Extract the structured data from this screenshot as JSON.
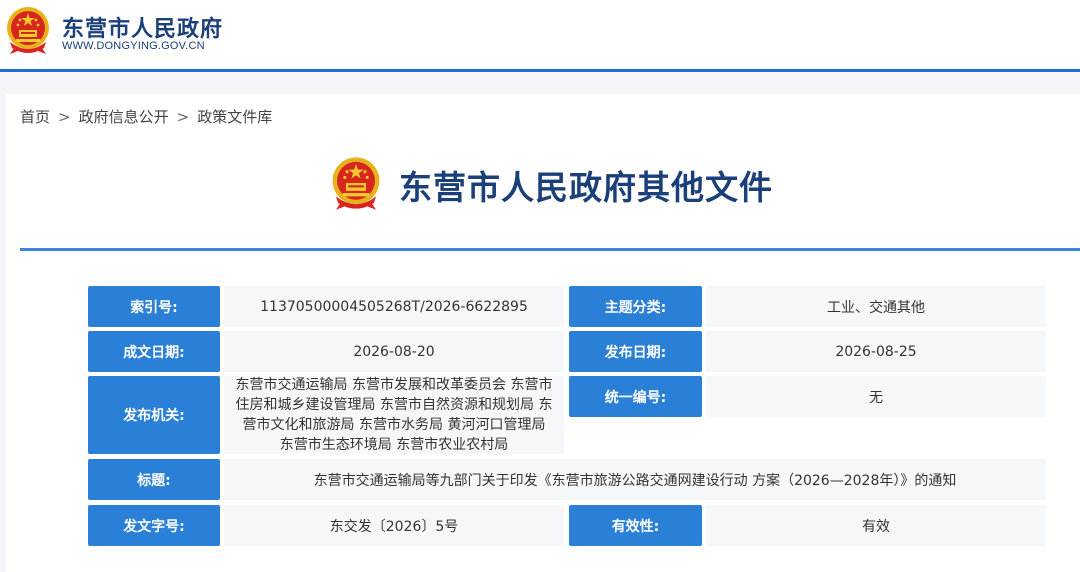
{
  "site": {
    "name": "东营市人民政府",
    "domain": "WWW.DONGYING.GOV.CN"
  },
  "breadcrumb": [
    "首页",
    "政府信息公开",
    "政策文件库"
  ],
  "breadcrumb_separator": ">",
  "page_heading": "东营市人民政府其他文件",
  "colors": {
    "brand_blue": "#1a3f7a",
    "label_blue": "#2a7fd6",
    "rule_blue": "#3a86e0"
  },
  "info": {
    "index_no": {
      "label": "索引号:",
      "value": "11370500004505268T/2026-6622895"
    },
    "topic": {
      "label": "主题分类:",
      "value": "工业、交通其他"
    },
    "created_date": {
      "label": "成文日期:",
      "value": "2026-08-20"
    },
    "published_date": {
      "label": "发布日期:",
      "value": "2026-08-25"
    },
    "issuer": {
      "label": "发布机关:",
      "value_lines": [
        "东营市交通运输局 东营市发展和改革委员会 东营市",
        "住房和城乡建设管理局 东营市自然资源和规划局 东",
        "营市文化和旅游局 东营市水务局 黄河河口管理局",
        "东营市生态环境局 东营市农业农村局"
      ]
    },
    "unified_no": {
      "label": "统一编号:",
      "value": "无"
    },
    "title": {
      "label": "标题:",
      "value": "东营市交通运输局等九部门关于印发《东营市旅游公路交通网建设行动 方案（2026—2028年）》的通知"
    },
    "doc_no": {
      "label": "发文字号:",
      "value": "东交发〔2026〕5号"
    },
    "validity": {
      "label": "有效性:",
      "value": "有效"
    }
  }
}
